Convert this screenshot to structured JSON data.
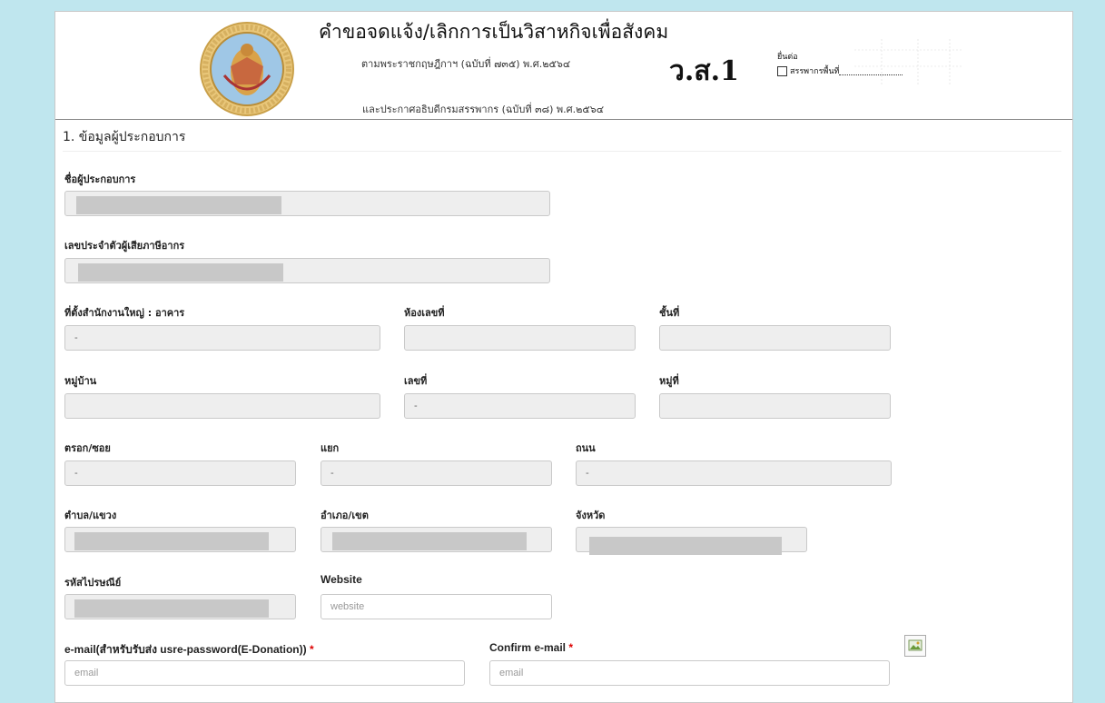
{
  "header": {
    "title": "คำขอจดแจ้ง/เลิกการเป็นวิสาหกิจเพื่อสังคม",
    "subtitle_1": "ตามพระราชกฤษฎีกาฯ (ฉบับที่ ๗๓๕) พ.ศ.๒๕๖๔",
    "subtitle_2": "และประกาศอธิบดีกรมสรรพากร (ฉบับที่ ๓๘) พ.ศ.๒๕๖๔",
    "form_code": "ว.ส.1",
    "submit_label": "ยื่นต่อ",
    "branch_label": "สรรพากรพื้นที่"
  },
  "section": {
    "title": "1. ข้อมูลผู้ประกอบการ"
  },
  "fields": {
    "operator_name": {
      "label": "ชื่อผู้ประกอบการ",
      "value": ""
    },
    "tax_id": {
      "label": "เลขประจำตัวผู้เสียภาษีอากร",
      "value": ""
    },
    "building": {
      "label": "ที่ตั้งสำนักงานใหญ่ : อาคาร",
      "value": "-"
    },
    "room_no": {
      "label": "ห้องเลขที่",
      "value": ""
    },
    "floor": {
      "label": "ชั้นที่",
      "value": ""
    },
    "village": {
      "label": "หมู่บ้าน",
      "value": ""
    },
    "house_no": {
      "label": "เลขที่",
      "value": "-"
    },
    "moo": {
      "label": "หมู่ที่",
      "value": ""
    },
    "soi": {
      "label": "ตรอก/ซอย",
      "value": "-"
    },
    "yaek": {
      "label": "แยก",
      "value": "-"
    },
    "road": {
      "label": "ถนน",
      "value": "-"
    },
    "subdistrict": {
      "label": "ตำบล/แขวง",
      "value": ""
    },
    "district": {
      "label": "อำเภอ/เขต",
      "value": ""
    },
    "province": {
      "label": "จังหวัด",
      "value": ""
    },
    "postcode": {
      "label": "รหัสไปรษณีย์",
      "value": ""
    },
    "website": {
      "label": "Website",
      "placeholder": "website"
    },
    "email": {
      "label": "e-mail(สำหรับรับส่ง usre-password(E-Donation))",
      "placeholder": "email",
      "required": "*"
    },
    "confirm_email": {
      "label": "Confirm e-mail",
      "placeholder": "email",
      "required": "*"
    }
  },
  "colors": {
    "background": "#bfe6ee",
    "required": "#dd0000",
    "field_disabled": "#eeeeee"
  },
  "icons": {
    "seal": "revenue-department-seal-icon",
    "broken_image": "broken-image-icon"
  }
}
